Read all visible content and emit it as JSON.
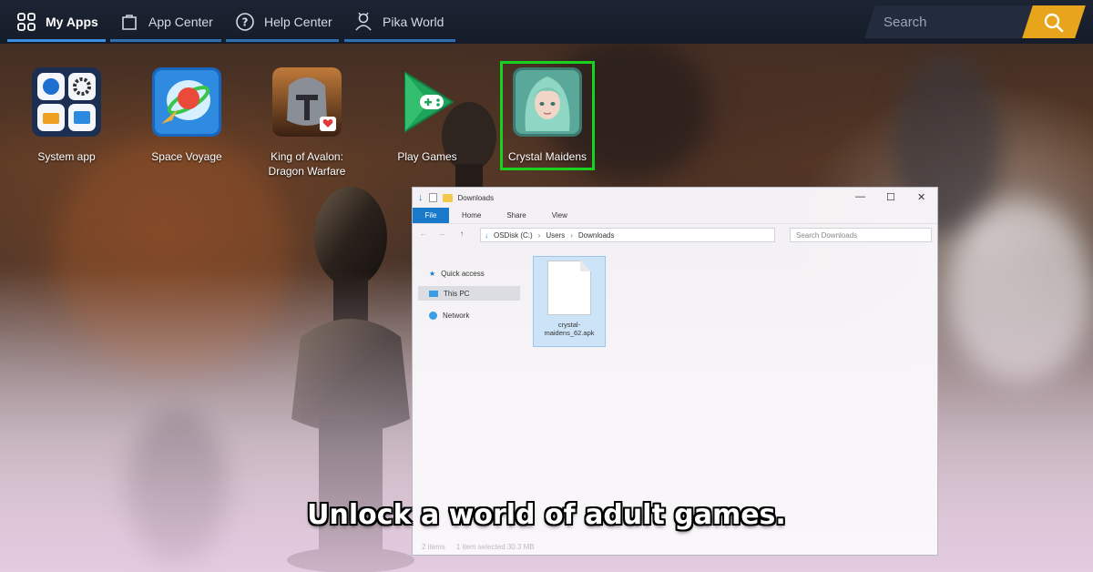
{
  "topbar": {
    "tabs": [
      {
        "label": "My Apps",
        "icon": "grid-icon",
        "active": true
      },
      {
        "label": "App Center",
        "icon": "bag-icon",
        "active": false
      },
      {
        "label": "Help Center",
        "icon": "help-icon",
        "active": false
      },
      {
        "label": "Pika World",
        "icon": "person-icon",
        "active": false
      }
    ],
    "search_placeholder": "Search",
    "search_button_color": "#e8a51c",
    "active_tab_color": "#3d8de0"
  },
  "apps": [
    {
      "label": "System app",
      "icon": "system-app-icon",
      "selected": false
    },
    {
      "label": "Space Voyage",
      "icon": "space-voyage-icon",
      "selected": false
    },
    {
      "label": "King of Avalon: Dragon Warfare",
      "icon": "king-of-avalon-icon",
      "selected": false
    },
    {
      "label": "Play Games",
      "icon": "play-games-icon",
      "selected": false
    },
    {
      "label": "Crystal Maidens",
      "icon": "crystal-maidens-icon",
      "selected": true
    }
  ],
  "explorer": {
    "title": "Downloads",
    "ribbon_tabs": [
      "File",
      "Home",
      "Share",
      "View"
    ],
    "path": [
      "OSDisk (C:)",
      "Users",
      "Downloads"
    ],
    "search_placeholder": "Search Downloads",
    "nav_items": [
      "Quick access",
      "This PC",
      "Network"
    ],
    "file_name": "crystal-maidens_62.apk",
    "status_items": "2 items",
    "status_selected": "1 item selected  30.3 MB"
  },
  "caption": "Unlock a world of adult games.",
  "colors": {
    "selection_outline": "#19d11f",
    "file_tab": "#1979ca"
  }
}
